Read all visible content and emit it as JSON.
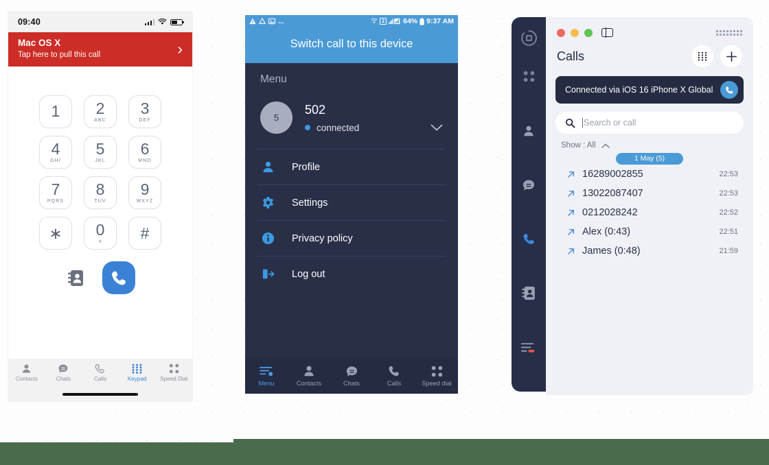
{
  "canvas": {
    "background": "#fdfdfd",
    "band_color": "#4a6b4c"
  },
  "phone1": {
    "platform": "ios",
    "status_bar": {
      "time": "09:40",
      "signal_icon": "cellular-signal-icon",
      "wifi_icon": "wifi-icon",
      "battery_icon": "battery-icon"
    },
    "pull_banner": {
      "title": "Mac OS X",
      "subtitle": "Tap here to pull this call",
      "chevron_icon": "chevron-right-icon",
      "color": "#cc2d26"
    },
    "keypad": {
      "keys": [
        {
          "num": "1",
          "sub": ""
        },
        {
          "num": "2",
          "sub": "ABC"
        },
        {
          "num": "3",
          "sub": "DEF"
        },
        {
          "num": "4",
          "sub": "GHI"
        },
        {
          "num": "5",
          "sub": "JKL"
        },
        {
          "num": "6",
          "sub": "MNO"
        },
        {
          "num": "7",
          "sub": "PQRS"
        },
        {
          "num": "8",
          "sub": "TUV"
        },
        {
          "num": "9",
          "sub": "WXYZ"
        },
        {
          "num": "∗",
          "sub": ""
        },
        {
          "num": "0",
          "sub": "+"
        },
        {
          "num": "#",
          "sub": ""
        }
      ],
      "contacts_icon": "address-book-icon",
      "call_icon": "phone-call-icon",
      "call_button_color": "#3b82d6"
    },
    "tabbar": {
      "active": "Keypad",
      "accent": "#3b82d6",
      "items": [
        {
          "label": "Contacts",
          "icon": "contacts-icon"
        },
        {
          "label": "Chats",
          "icon": "chats-icon"
        },
        {
          "label": "Calls",
          "icon": "calls-icon"
        },
        {
          "label": "Keypad",
          "icon": "keypad-icon"
        },
        {
          "label": "Speed Dial",
          "icon": "speed-dial-icon"
        }
      ]
    }
  },
  "phone2": {
    "platform": "android",
    "status_bar": {
      "left_icons": "warning-icon drive-icon image-icon",
      "overflow": "...",
      "wifi_icon": "wifi-icon",
      "sim_badge": "2",
      "signal_icon": "signal-bars-icon",
      "battery_percent": "64%",
      "time": "9:37 AM"
    },
    "banner": {
      "text": "Switch call to this device",
      "color": "#4a9ad6"
    },
    "menu_header": "Menu",
    "profile": {
      "avatar_initial": "5",
      "extension": "502",
      "status": "connected",
      "status_dot_color": "#3b9ae1",
      "expand_icon": "chevron-down-icon"
    },
    "menu_items": [
      {
        "label": "Profile",
        "icon": "person-icon"
      },
      {
        "label": "Settings",
        "icon": "gear-icon"
      },
      {
        "label": "Privacy policy",
        "icon": "info-icon"
      },
      {
        "label": "Log out",
        "icon": "logout-icon"
      }
    ],
    "tabbar": {
      "active": "Menu",
      "accent": "#4e9ae6",
      "items": [
        {
          "label": "Menu",
          "icon": "menu-icon"
        },
        {
          "label": "Contacts",
          "icon": "contacts-icon"
        },
        {
          "label": "Chats",
          "icon": "chats-icon"
        },
        {
          "label": "Calls",
          "icon": "calls-icon"
        },
        {
          "label": "Speed dial",
          "icon": "speed-dial-icon"
        }
      ]
    }
  },
  "mac": {
    "sidebar": {
      "logo_icon": "app-logo-icon",
      "items": [
        {
          "icon": "speed-dial-icon",
          "active": false
        },
        {
          "icon": "contacts-icon",
          "active": false
        },
        {
          "icon": "chats-icon",
          "active": false
        },
        {
          "icon": "calls-icon",
          "active": true
        },
        {
          "icon": "address-book-icon",
          "active": false
        },
        {
          "icon": "menu-icon",
          "active": false,
          "badge": true
        }
      ]
    },
    "titlebar": {
      "close_icon": "close-traffic-light",
      "minimize_icon": "minimize-traffic-light",
      "maximize_icon": "maximize-traffic-light",
      "sidebar_toggle_icon": "sidebar-toggle-icon",
      "drag_handle_icon": "drag-handle-icon"
    },
    "header": {
      "title": "Calls",
      "keypad_icon": "keypad-icon",
      "add_icon": "plus-icon"
    },
    "connected_banner": {
      "text": "Connected via iOS 16 iPhone X Global",
      "call_icon": "phone-call-icon",
      "color": "#242b42"
    },
    "search": {
      "placeholder": "Search or call",
      "icon": "search-icon"
    },
    "filter": {
      "label": "Show : All",
      "chevron_icon": "chevron-up-icon"
    },
    "date_pill": "1 May (5)",
    "calls": [
      {
        "direction_icon": "outgoing-call-icon",
        "name": "16289002855",
        "time": "22:53"
      },
      {
        "direction_icon": "outgoing-call-icon",
        "name": "13022087407",
        "time": "22:53"
      },
      {
        "direction_icon": "outgoing-call-icon",
        "name": "0212028242",
        "time": "22:52"
      },
      {
        "direction_icon": "outgoing-call-icon",
        "name": "Alex (0:43)",
        "time": "22:51"
      },
      {
        "direction_icon": "outgoing-call-icon",
        "name": "James (0:48)",
        "time": "21:59"
      }
    ]
  }
}
